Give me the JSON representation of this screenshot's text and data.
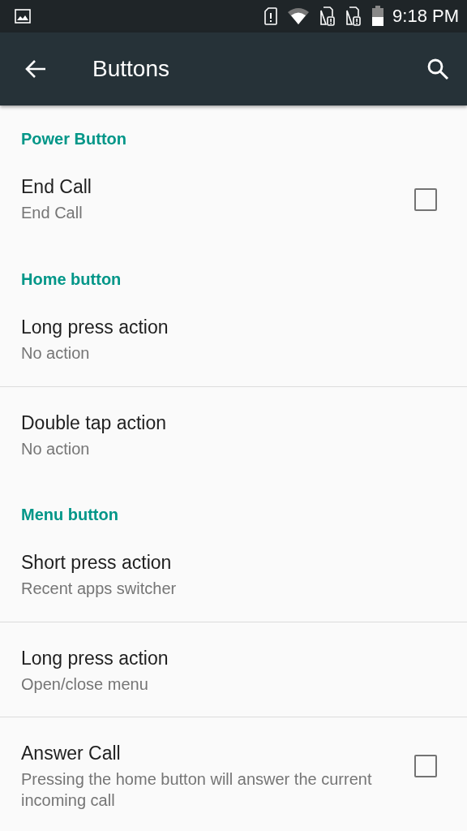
{
  "status_bar": {
    "time": "9:18 PM"
  },
  "toolbar": {
    "title": "Buttons"
  },
  "sections": [
    {
      "header": "Power Button",
      "items": [
        {
          "kind": "checkbox",
          "title": "End Call",
          "summary": "End Call",
          "checked": false
        }
      ]
    },
    {
      "header": "Home button",
      "items": [
        {
          "kind": "plain",
          "title": "Long press action",
          "summary": "No action"
        },
        {
          "kind": "plain",
          "title": "Double tap action",
          "summary": "No action"
        }
      ]
    },
    {
      "header": "Menu button",
      "items": [
        {
          "kind": "plain",
          "title": "Short press action",
          "summary": "Recent apps switcher"
        },
        {
          "kind": "plain",
          "title": "Long press action",
          "summary": "Open/close menu"
        },
        {
          "kind": "checkbox",
          "title": "Answer Call",
          "summary": "Pressing the home button will answer the current incoming call",
          "checked": false
        }
      ]
    }
  ]
}
